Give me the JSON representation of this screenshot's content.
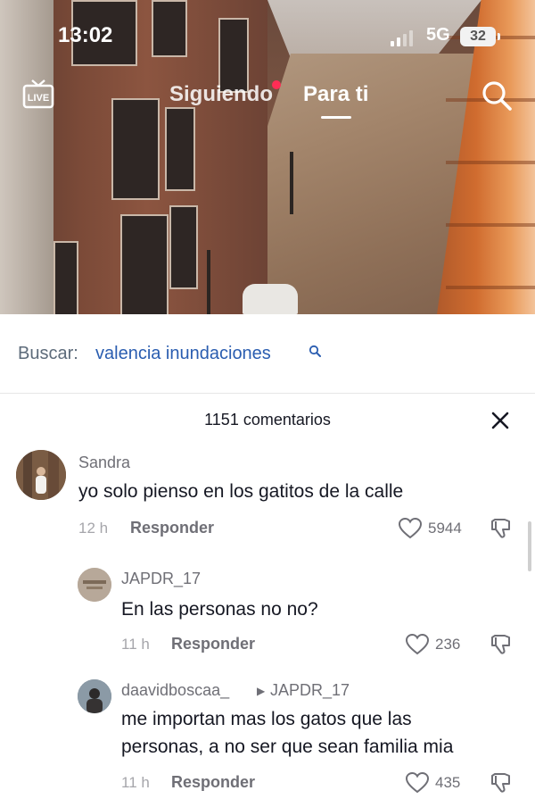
{
  "status_bar": {
    "time": "13:02",
    "network": "5G",
    "battery": "32"
  },
  "top_nav": {
    "live_label": "LIVE",
    "following": "Siguiendo",
    "for_you": "Para ti"
  },
  "search": {
    "prefix": "Buscar:",
    "query": "valencia inundaciones"
  },
  "comments": {
    "count_label": "1151 comentarios",
    "items": [
      {
        "user": "Sandra",
        "text": "yo solo pienso en los gatitos de la calle",
        "time": "12 h",
        "reply": "Responder",
        "likes": "5944"
      },
      {
        "user": "JAPDR_17",
        "text": "En las personas no no?",
        "time": "11 h",
        "reply": "Responder",
        "likes": "236"
      },
      {
        "user": "daavidboscaa_",
        "reply_to": "JAPDR_17",
        "text_line1": "me importan mas los gatos que las",
        "text_line2": "personas, a no ser que sean familia mia",
        "time": "11 h",
        "reply": "Responder",
        "likes": "435"
      }
    ]
  },
  "colors": {
    "link_blue": "#2a5db0",
    "live_dot": "#ff2d55",
    "text_dark": "#161823",
    "text_muted": "#6f6f76"
  },
  "icons": [
    "live-icon",
    "search-icon",
    "close-icon",
    "heart-icon",
    "dislike-icon"
  ]
}
